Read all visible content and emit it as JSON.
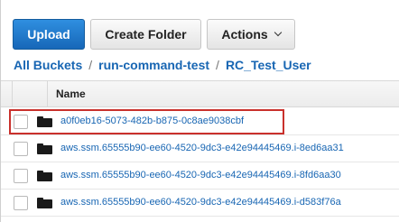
{
  "toolbar": {
    "upload_label": "Upload",
    "create_folder_label": "Create Folder",
    "actions_label": "Actions"
  },
  "breadcrumb": [
    "All Buckets",
    "run-command-test",
    "RC_Test_User"
  ],
  "breadcrumb_separator": "/",
  "table": {
    "column_name": "Name",
    "rows": [
      "a0f0eb16-5073-482b-b875-0c8ae9038cbf",
      "aws.ssm.65555b90-ee60-4520-9dc3-e42e94445469.i-8ed6aa31",
      "aws.ssm.65555b90-ee60-4520-9dc3-e42e94445469.i-8fd6aa30",
      "aws.ssm.65555b90-ee60-4520-9dc3-e42e94445469.i-d583f76a"
    ]
  },
  "colors": {
    "link": "#1866b3",
    "primary": "#1f77cc",
    "highlight": "#c9302c"
  }
}
